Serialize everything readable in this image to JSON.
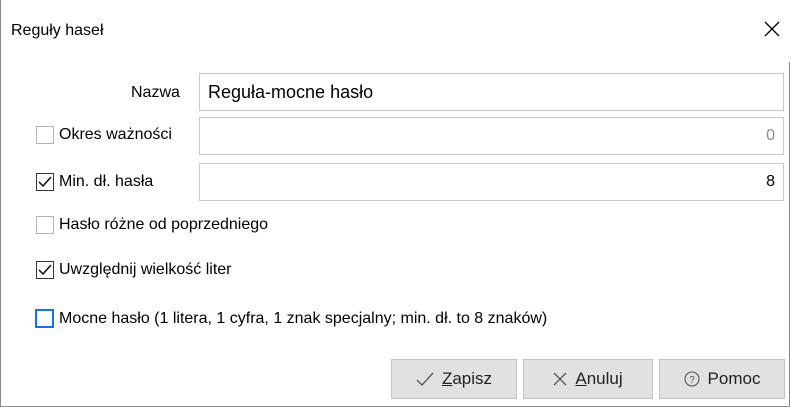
{
  "window": {
    "title": "Reguły haseł"
  },
  "fields": {
    "name_label": "Nazwa",
    "name_value": "Reguła-mocne hasło",
    "validity_label": "Okres ważności",
    "validity_value": "0",
    "validity_checked": false,
    "minlen_label": "Min. dł. hasła",
    "minlen_value": "8",
    "minlen_checked": true
  },
  "options": {
    "different_label": "Hasło różne od poprzedniego",
    "different_checked": false,
    "case_label": "Uwzględnij wielkość liter",
    "case_checked": true,
    "strong_label": "Mocne hasło (1 litera, 1 cyfra, 1 znak specjalny; min. dł. to 8 znaków)",
    "strong_checked": false
  },
  "buttons": {
    "save_first": "Z",
    "save_rest": "apisz",
    "cancel_first": "A",
    "cancel_rest": "nuluj",
    "help_label": "Pomoc"
  },
  "icons": {
    "close": "close-icon",
    "check": "checkmark-icon",
    "x": "x-icon",
    "help": "help-circle-icon"
  },
  "colors": {
    "focus_border": "#1473e6",
    "button_bg": "#e1e1e1"
  }
}
